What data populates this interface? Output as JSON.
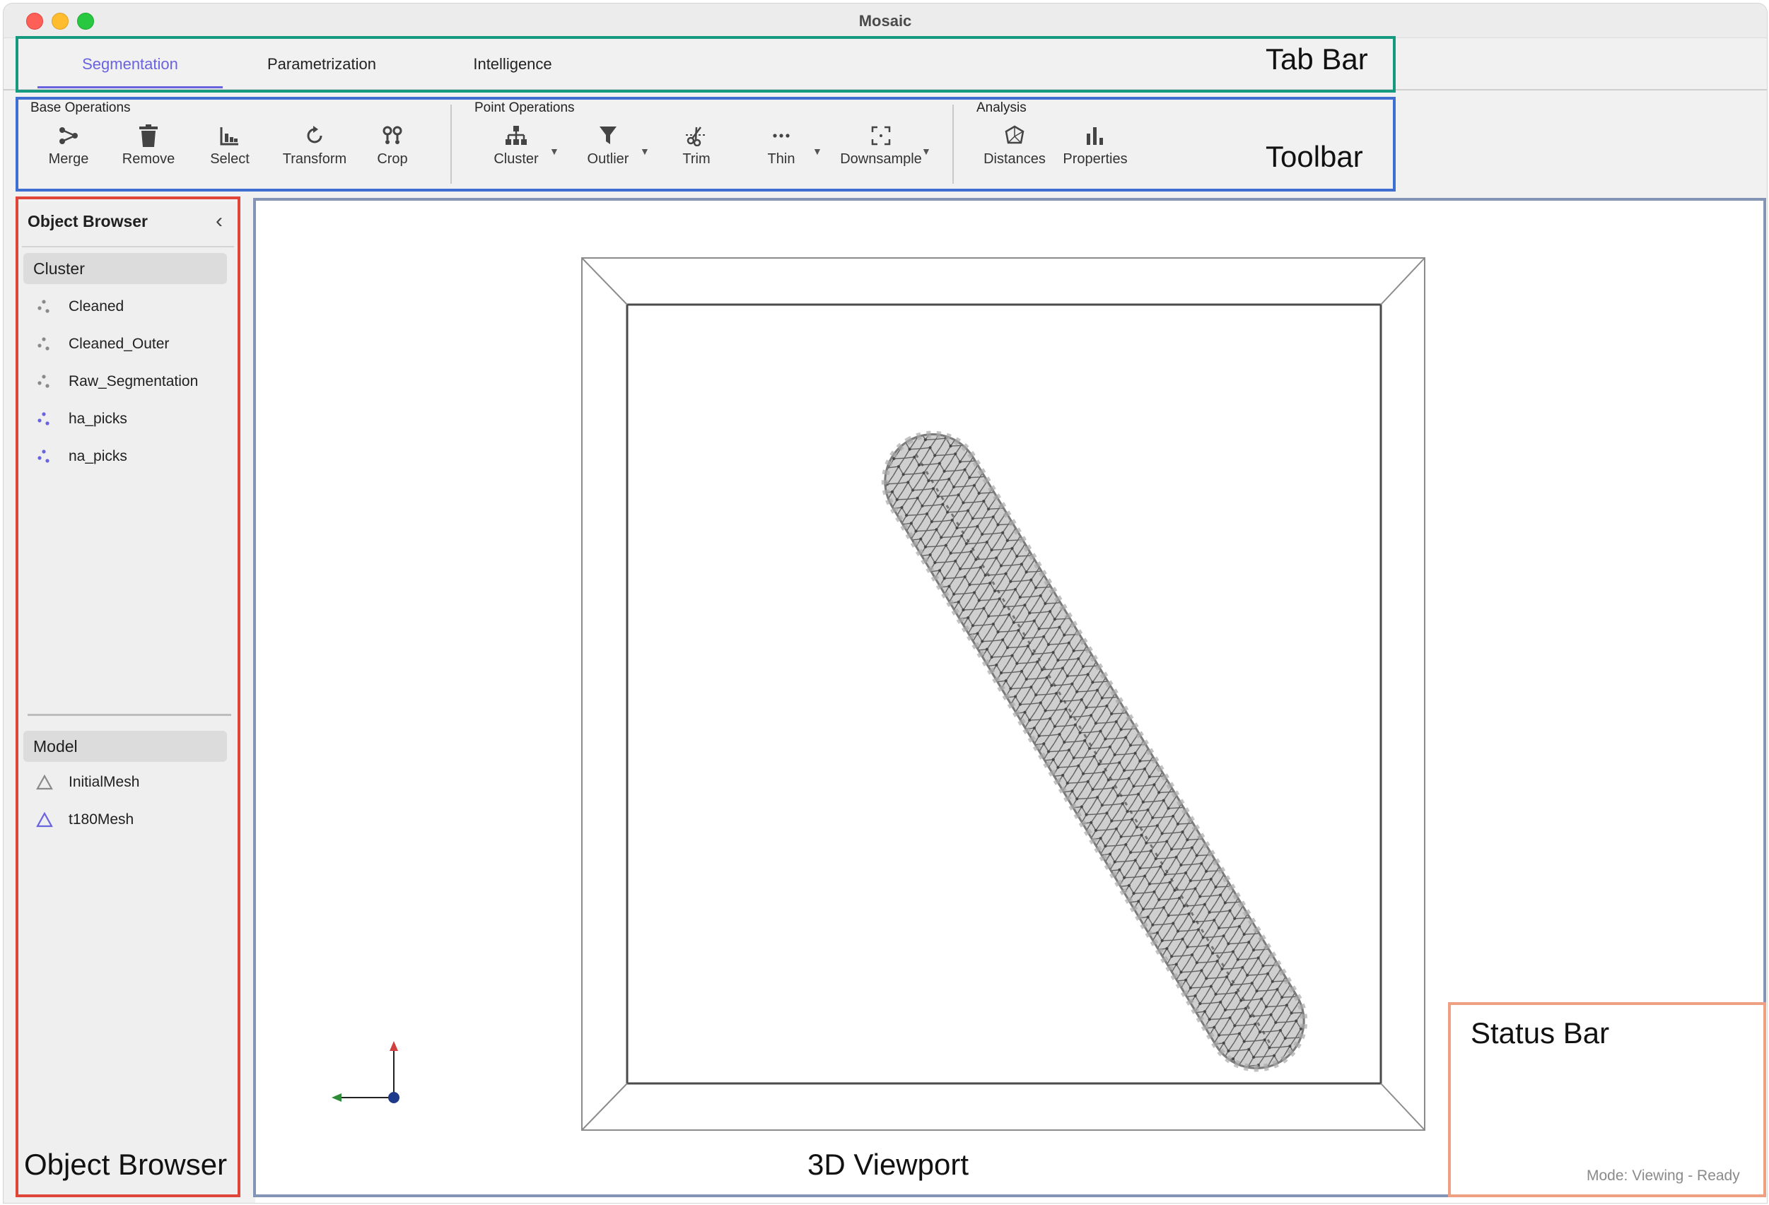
{
  "window": {
    "title": "Mosaic"
  },
  "tabs": [
    {
      "label": "Segmentation",
      "active": true
    },
    {
      "label": "Parametrization",
      "active": false
    },
    {
      "label": "Intelligence",
      "active": false
    }
  ],
  "toolbar": {
    "groups": [
      {
        "label": "Base Operations",
        "tools": [
          "Merge",
          "Remove",
          "Select",
          "Transform",
          "Crop"
        ]
      },
      {
        "label": "Point Operations",
        "tools": [
          "Cluster",
          "Outlier",
          "Trim",
          "Thin",
          "Downsample"
        ]
      },
      {
        "label": "Analysis",
        "tools": [
          "Distances",
          "Properties"
        ]
      }
    ]
  },
  "browser": {
    "title": "Object Browser",
    "sections": [
      {
        "label": "Cluster",
        "items": [
          "Cleaned",
          "Cleaned_Outer",
          "Raw_Segmentation",
          "ha_picks",
          "na_picks"
        ]
      },
      {
        "label": "Model",
        "items": [
          "InitialMesh",
          "t180Mesh"
        ]
      }
    ]
  },
  "status": {
    "text": "Mode: Viewing - Ready"
  },
  "annotations": {
    "tab_bar": "Tab Bar",
    "toolbar": "Toolbar",
    "object_browser": "Object Browser",
    "viewport": "3D Viewport",
    "status_bar": "Status Bar"
  },
  "colors": {
    "accent": "#6a63e0",
    "anno_tab": "#159a80",
    "anno_toolbar": "#3f6fd1",
    "anno_browser": "#e0453a",
    "anno_viewport": "#8494b5",
    "anno_status": "#f0a082",
    "axis_x": "#2e8b3a",
    "axis_y": "#d0403c",
    "axis_z": "#1f3a8a"
  }
}
